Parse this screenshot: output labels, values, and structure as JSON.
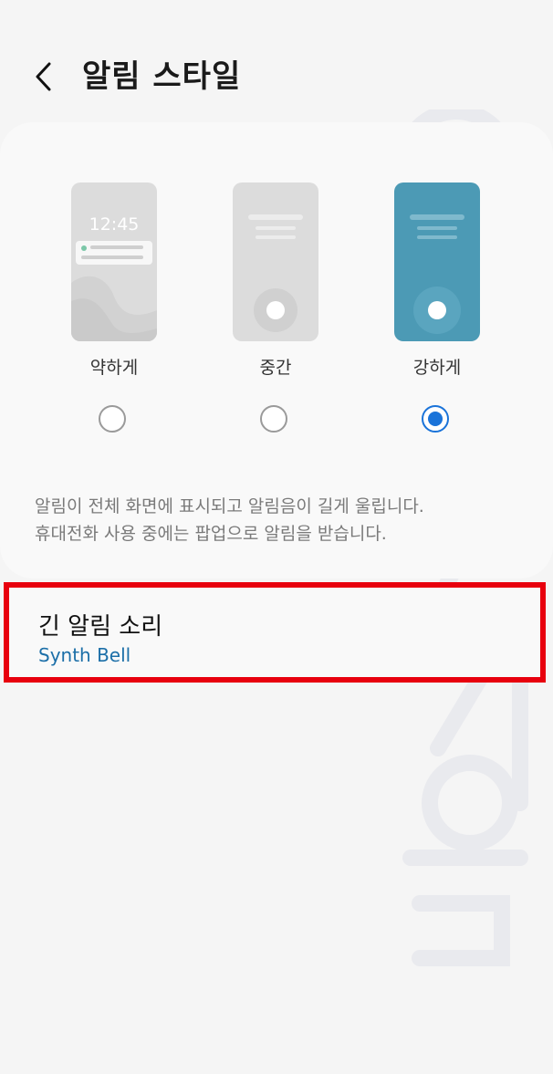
{
  "header": {
    "title": "알림 스타일",
    "back_icon": "chevron-left-icon"
  },
  "styles": {
    "options": [
      {
        "label": "약하게",
        "preview_time": "12:45",
        "selected": false
      },
      {
        "label": "중간",
        "selected": false
      },
      {
        "label": "강하게",
        "selected": true
      }
    ],
    "description_lines": [
      "알림이 전체 화면에 표시되고 알림음이 길게 울립니다.",
      "휴대전화 사용 중에는 팝업으로 알림을 받습니다."
    ]
  },
  "long_alert_sound": {
    "title": "긴 알림 소리",
    "value": "Synth Bell"
  },
  "colors": {
    "accent": "#1a73d9",
    "selected_preview": "#4c9ab5",
    "highlight_border": "#e8000e",
    "value_text": "#1c6fa8"
  }
}
